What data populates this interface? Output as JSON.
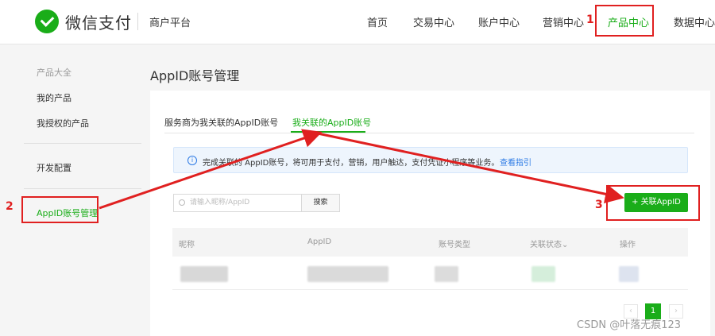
{
  "header": {
    "brand": "微信支付",
    "platform": "商户平台",
    "nav": [
      "首页",
      "交易中心",
      "账户中心",
      "营销中心",
      "产品中心",
      "数据中心"
    ]
  },
  "sidebar": {
    "heading": "产品大全",
    "items": [
      "我的产品",
      "我授权的产品",
      "开发配置",
      "AppID账号管理"
    ]
  },
  "main": {
    "title": "AppID账号管理",
    "tabs": [
      "服务商为我关联的AppID账号",
      "我关联的AppID账号"
    ],
    "notice": "完成关联的 AppID账号，将可用于支付，营销，用户触达，支付凭证小程序等业务。",
    "notice_link": "查看指引",
    "search_placeholder": "请输入昵称/AppID",
    "search_button": "搜索",
    "add_button": "+ 关联AppID",
    "columns": [
      "昵称",
      "AppID",
      "账号类型",
      "关联状态⌄",
      "操作"
    ],
    "pagination": {
      "prev": "‹",
      "current": "1",
      "next": "›"
    }
  },
  "annotations": [
    "1",
    "2",
    "3"
  ],
  "watermark": "CSDN @叶落无痕123",
  "colors": {
    "accent": "#1aad19",
    "annotation": "#e02020",
    "link": "#2d7be5"
  }
}
